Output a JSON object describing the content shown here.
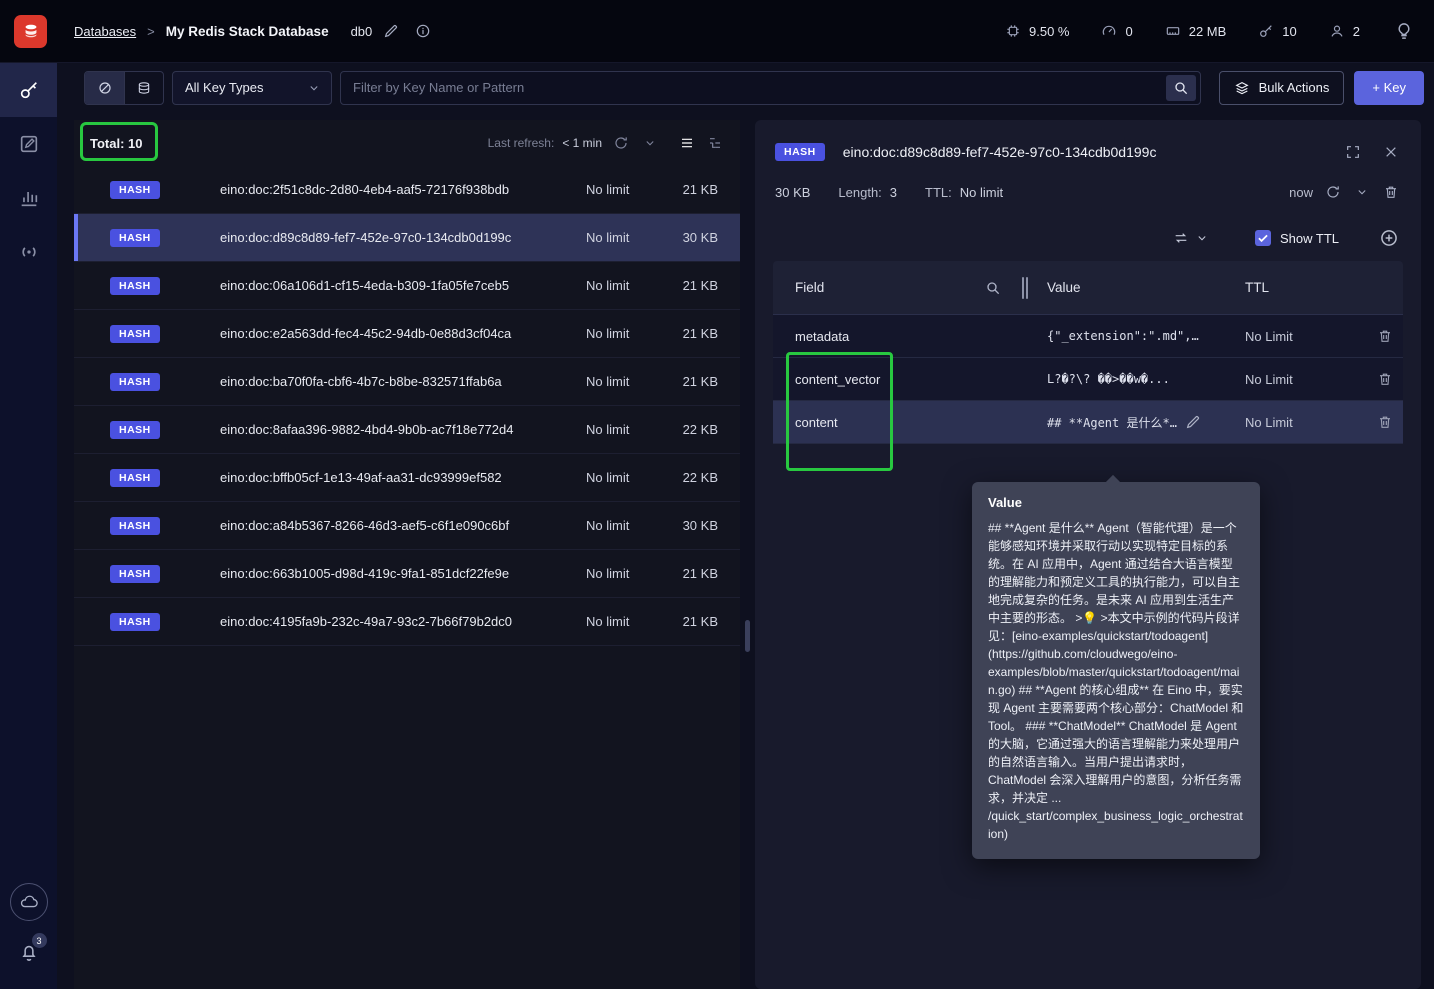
{
  "colors": {
    "accent_blue": "#5b64dd",
    "hash_badge": "#4a51e0",
    "annotation_green": "#28c840",
    "logo_red": "#dc382c",
    "selected_row": "#2e3357"
  },
  "topbar": {
    "breadcrumb": "Databases",
    "separator": ">",
    "title": "My Redis Stack Database",
    "db_name": "db0",
    "stats": [
      {
        "icon": "cpu-icon",
        "value": "9.50 %"
      },
      {
        "icon": "commands-gauge-icon",
        "value": "0"
      },
      {
        "icon": "memory-icon",
        "value": "22 MB"
      },
      {
        "icon": "keys-icon",
        "value": "10"
      },
      {
        "icon": "clients-icon",
        "value": "2"
      }
    ]
  },
  "sidebar": {
    "items": [
      {
        "icon": "browser-keys-icon",
        "active": true
      },
      {
        "icon": "workbench-icon",
        "active": false
      },
      {
        "icon": "analytics-icon",
        "active": false
      },
      {
        "icon": "pubsub-icon",
        "active": false
      }
    ],
    "cloud_icon": "cloud-icon",
    "notification_count": "3"
  },
  "filterbar": {
    "key_type_selected": "All Key Types",
    "search_placeholder": "Filter by Key Name or Pattern",
    "bulk_actions_label": "Bulk Actions",
    "add_key_label": "+ Key"
  },
  "keylist": {
    "total_label": "Total: 10",
    "last_refresh_label": "Last refresh:",
    "last_refresh_value": "< 1 min",
    "rows": [
      {
        "badge": "HASH",
        "name": "eino:doc:2f51c8dc-2d80-4eb4-aaf5-72176f938bdb",
        "ttl": "No limit",
        "size": "21 KB"
      },
      {
        "badge": "HASH",
        "name": "eino:doc:d89c8d89-fef7-452e-97c0-134cdb0d199c",
        "ttl": "No limit",
        "size": "30 KB"
      },
      {
        "badge": "HASH",
        "name": "eino:doc:06a106d1-cf15-4eda-b309-1fa05fe7ceb5",
        "ttl": "No limit",
        "size": "21 KB"
      },
      {
        "badge": "HASH",
        "name": "eino:doc:e2a563dd-fec4-45c2-94db-0e88d3cf04ca",
        "ttl": "No limit",
        "size": "21 KB"
      },
      {
        "badge": "HASH",
        "name": "eino:doc:ba70f0fa-cbf6-4b7c-b8be-832571ffab6a",
        "ttl": "No limit",
        "size": "21 KB"
      },
      {
        "badge": "HASH",
        "name": "eino:doc:8afaa396-9882-4bd4-9b0b-ac7f18e772d4",
        "ttl": "No limit",
        "size": "22 KB"
      },
      {
        "badge": "HASH",
        "name": "eino:doc:bffb05cf-1e13-49af-aa31-dc93999ef582",
        "ttl": "No limit",
        "size": "22 KB"
      },
      {
        "badge": "HASH",
        "name": "eino:doc:a84b5367-8266-46d3-aef5-c6f1e090c6bf",
        "ttl": "No limit",
        "size": "30 KB"
      },
      {
        "badge": "HASH",
        "name": "eino:doc:663b1005-d98d-419c-9fa1-851dcf22fe9e",
        "ttl": "No limit",
        "size": "21 KB"
      },
      {
        "badge": "HASH",
        "name": "eino:doc:4195fa9b-232c-49a7-93c2-7b66f79b2dc0",
        "ttl": "No limit",
        "size": "21 KB"
      }
    ]
  },
  "details": {
    "badge": "HASH",
    "key": "eino:doc:d89c8d89-fef7-452e-97c0-134cdb0d199c",
    "size": "30 KB",
    "length_label": "Length:",
    "length_value": "3",
    "ttl_label": "TTL:",
    "ttl_value": "No limit",
    "refreshed": "now",
    "show_ttl_label": "Show TTL",
    "table": {
      "col_field": "Field",
      "col_value": "Value",
      "col_ttl": "TTL",
      "rows": [
        {
          "field": "metadata",
          "value": "{\"_extension\":\".md\",\"_fi...",
          "ttl": "No Limit"
        },
        {
          "field": "content_vector",
          "value": "L?�?\\? ��>��w�...",
          "ttl": "No Limit"
        },
        {
          "field": "content",
          "value": "## **Agent 是什么** A...",
          "ttl": "No Limit"
        }
      ]
    },
    "value_tooltip": {
      "title": "Value",
      "body": "## **Agent 是什么** Agent（智能代理）是一个能够感知环境并采取行动以实现特定目标的系统。在 AI 应用中，Agent 通过结合大语言模型的理解能力和预定义工具的执行能力，可以自主地完成复杂的任务。是未来 AI 应用到生活生产中主要的形态。 >💡 >本文中示例的代码片段详见：[eino-examples/quickstart/todoagent](https://github.com/cloudwego/eino-examples/blob/master/quickstart/todoagent/main.go) ## **Agent 的核心组成** 在 Eino 中，要实现 Agent 主要需要两个核心部分：ChatModel 和 Tool。 ### **ChatModel** ChatModel 是 Agent 的大脑，它通过强大的语言理解能力来处理用户的自然语言输入。当用户提出请求时，ChatModel 会深入理解用户的意图，分析任务需求，并决定 ... /quick_start/complex_business_logic_orchestration)"
    }
  }
}
